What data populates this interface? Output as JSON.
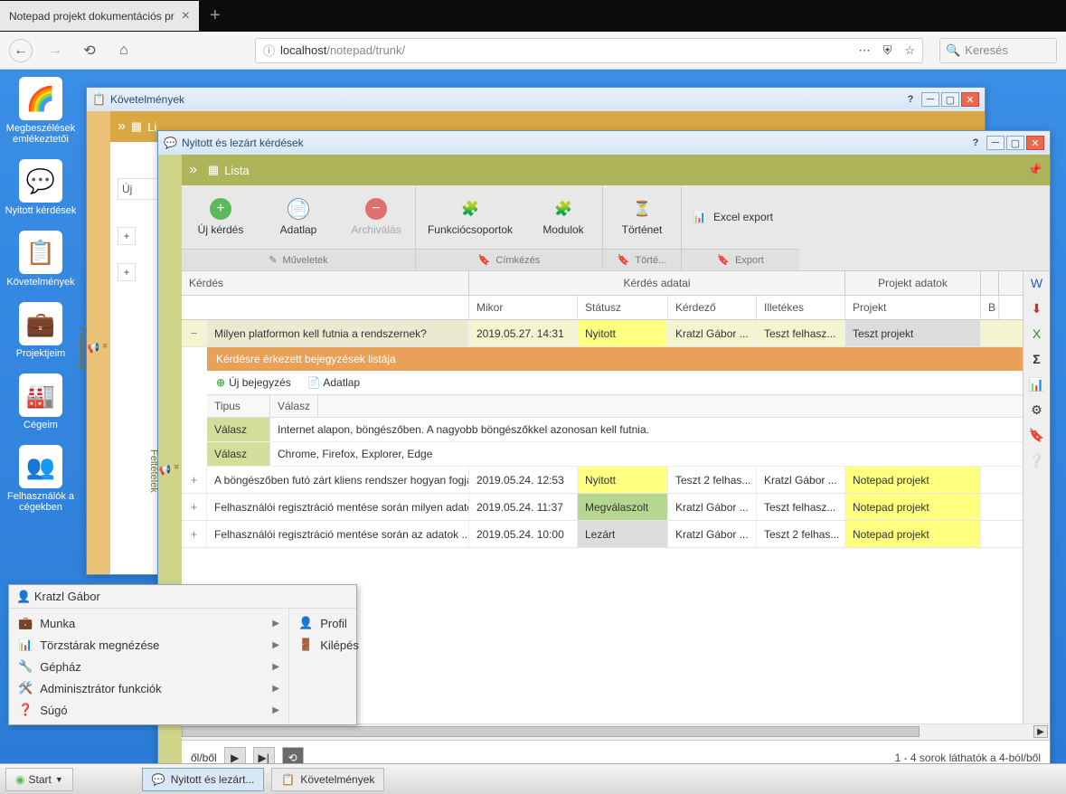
{
  "browser": {
    "tab_title": "Notepad projekt dokumentációs pr",
    "url_host": "localhost",
    "url_path": "/notepad/trunk/",
    "search_placeholder": "Keresés"
  },
  "desktop_icons": [
    {
      "label": "Megbeszélések emlékeztetői",
      "glyph": "🌈"
    },
    {
      "label": "Nyitott kérdések",
      "glyph": "💬"
    },
    {
      "label": "Követelmények",
      "glyph": "📋"
    },
    {
      "label": "Projektjeim",
      "glyph": "💼"
    },
    {
      "label": "Cégeim",
      "glyph": "🏭"
    },
    {
      "label": "Felhasználók a cégekben",
      "glyph": "👥"
    }
  ],
  "win_req": {
    "title": "Követelmények",
    "list_label": "Li",
    "side_label": "Feltételek"
  },
  "win_q": {
    "title": "Nyitott és lezárt kérdések",
    "side_label": "Feltételek",
    "list_label": "Lista",
    "ribbon": {
      "new": "Új kérdés",
      "sheet": "Adatlap",
      "archive": "Archiválás",
      "funcgroups": "Funkciócsoportok",
      "modules": "Modulok",
      "history": "Történet",
      "excel": "Excel export",
      "g_ops": "Műveletek",
      "g_tag": "Címkézés",
      "g_hist": "Törté...",
      "g_export": "Export"
    },
    "columns": {
      "question": "Kérdés",
      "qdata": "Kérdés adatai",
      "pdata": "Projekt adatok",
      "when": "Mikor",
      "status": "Státusz",
      "asker": "Kérdező",
      "responsible": "Illetékes",
      "project": "Projekt",
      "b": "B"
    },
    "rows": [
      {
        "q": "Milyen platformon kell futnia a rendszernek?",
        "when": "2019.05.27. 14:31",
        "status": "Nyitott",
        "status_cls": "status-open",
        "asker": "Kratzl Gábor ...",
        "resp": "Teszt felhasz...",
        "proj": "Teszt projekt",
        "proj_cls": "proj-sel",
        "expanded": true
      },
      {
        "q": "A böngészőben futó zárt kliens rendszer hogyan fogja megoldani a nyomtatási feladatokat?",
        "when": "2019.05.24. 12:53",
        "status": "Nyitott",
        "status_cls": "status-open",
        "asker": "Teszt 2 felhas...",
        "resp": "Kratzl Gábor ...",
        "proj": "Notepad projekt",
        "proj_cls": "proj-hl"
      },
      {
        "q": "Felhasználói regisztráció mentése során milyen adatok egyediségét kell ellenőrizni?",
        "when": "2019.05.24. 11:37",
        "status": "Megválaszolt",
        "status_cls": "status-answer",
        "asker": "Kratzl Gábor ...",
        "resp": "Teszt felhasz...",
        "proj": "Notepad projekt",
        "proj_cls": "proj-hl"
      },
      {
        "q": "Felhasználói regisztráció mentése során az adatok ... azonosak a regisztráció",
        "when": "2019.05.24. 10:00",
        "status": "Lezárt",
        "status_cls": "status-closed",
        "asker": "Kratzl Gábor ...",
        "resp": "Teszt 2 felhas...",
        "proj": "Notepad projekt",
        "proj_cls": "proj-hl"
      }
    ],
    "detail": {
      "header": "Kérdésre érkezett bejegyzések listája",
      "new_entry": "Új bejegyzés",
      "sheet": "Adatlap",
      "col_type": "Tipus",
      "col_answer": "Válasz",
      "rows": [
        {
          "type": "Válasz",
          "answer": "Internet alapon, böngészőben. A nagyobb böngészőkkel azonosan kell futnia."
        },
        {
          "type": "Válasz",
          "answer": "Chrome, Firefox, Explorer, Edge"
        }
      ]
    },
    "pager": {
      "oflabel": "ől/ből",
      "info": "1 - 4 sorok láthatók a 4-ból/ből"
    }
  },
  "ctxmenu": {
    "user": "Kratzl Gábor",
    "left": [
      {
        "icon": "💼",
        "label": "Munka"
      },
      {
        "icon": "📊",
        "label": "Törzstárak megnézése"
      },
      {
        "icon": "🔧",
        "label": "Gépház"
      },
      {
        "icon": "🛠️",
        "label": "Adminisztrátor funkciók"
      },
      {
        "icon": "❓",
        "label": "Súgó"
      }
    ],
    "right": [
      {
        "icon": "👤",
        "label": "Profil"
      },
      {
        "icon": "🚪",
        "label": "Kilépés"
      }
    ]
  },
  "taskbar": {
    "start": "Start",
    "tasks": [
      {
        "icon": "💬",
        "label": "Nyitott és lezárt...",
        "active": true
      },
      {
        "icon": "📋",
        "label": "Követelmények",
        "active": false
      }
    ]
  }
}
